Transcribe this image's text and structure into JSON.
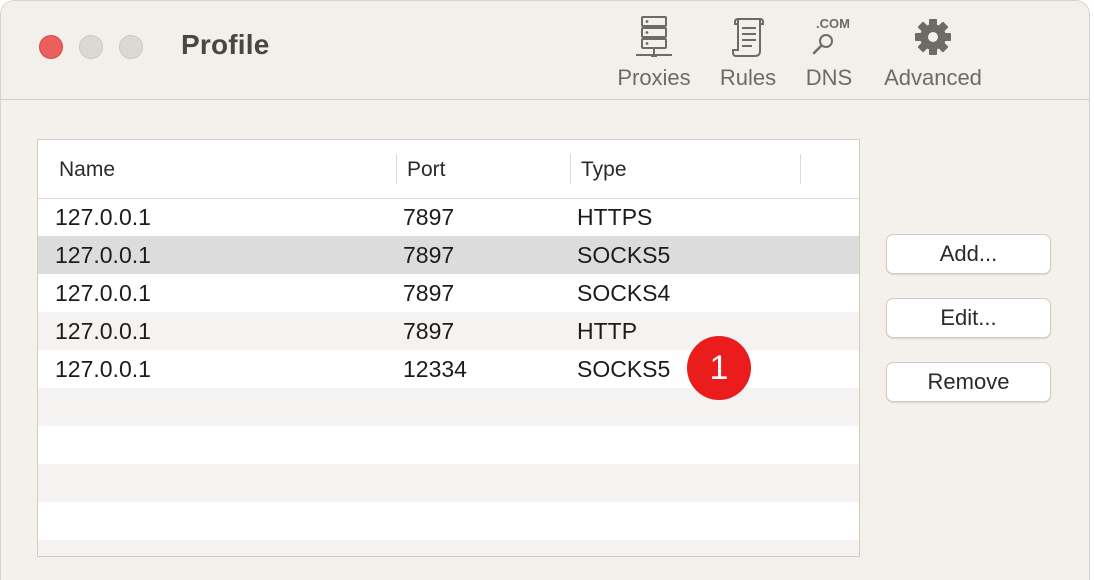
{
  "window": {
    "title": "Profile"
  },
  "toolbar": {
    "items": [
      {
        "label": "Proxies",
        "icon": "server-icon"
      },
      {
        "label": "Rules",
        "icon": "scroll-icon"
      },
      {
        "label": "DNS",
        "icon": "dns-search-icon",
        "icon_text": ".COM"
      },
      {
        "label": "Advanced",
        "icon": "gear-icon"
      }
    ]
  },
  "table": {
    "columns": [
      "Name",
      "Port",
      "Type"
    ],
    "rows": [
      {
        "name": "127.0.0.1",
        "port": "7897",
        "type": "HTTPS"
      },
      {
        "name": "127.0.0.1",
        "port": "7897",
        "type": "SOCKS5"
      },
      {
        "name": "127.0.0.1",
        "port": "7897",
        "type": "SOCKS4"
      },
      {
        "name": "127.0.0.1",
        "port": "7897",
        "type": "HTTP"
      },
      {
        "name": "127.0.0.1",
        "port": "12334",
        "type": "SOCKS5"
      }
    ],
    "selected_row": 1
  },
  "buttons": {
    "add": "Add...",
    "edit": "Edit...",
    "remove": "Remove"
  },
  "annotation": {
    "badge": "1"
  },
  "colors": {
    "close": "#ec5f5c",
    "badge": "#ea1c1c",
    "selected_row": "#dcdcdc"
  }
}
